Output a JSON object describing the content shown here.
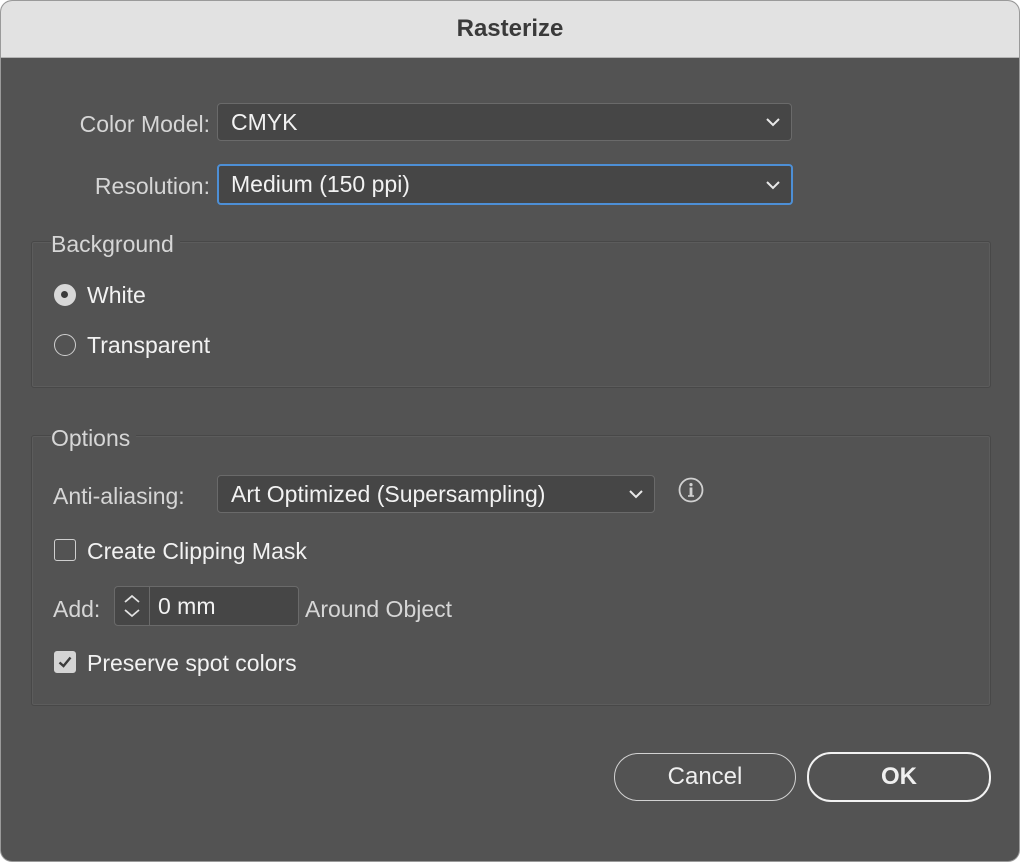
{
  "dialog": {
    "title": "Rasterize"
  },
  "color_model": {
    "label": "Color Model:",
    "value": "CMYK"
  },
  "resolution": {
    "label": "Resolution:",
    "value": "Medium (150 ppi)"
  },
  "background": {
    "legend": "Background",
    "options": [
      {
        "label": "White",
        "selected": true
      },
      {
        "label": "Transparent",
        "selected": false
      }
    ]
  },
  "options": {
    "legend": "Options",
    "anti_aliasing": {
      "label": "Anti-aliasing:",
      "value": "Art Optimized (Supersampling)"
    },
    "info_icon": "info-icon",
    "clipping_mask": {
      "label": "Create Clipping Mask",
      "checked": false
    },
    "add": {
      "label": "Add:",
      "value": "0 mm",
      "suffix": "Around Object"
    },
    "spot_colors": {
      "label": "Preserve spot colors",
      "checked": true
    }
  },
  "buttons": {
    "cancel": "Cancel",
    "ok": "OK"
  },
  "colors": {
    "panel": "#535353",
    "titlebar": "#e2e2e2",
    "focus": "#4d8fd6"
  }
}
